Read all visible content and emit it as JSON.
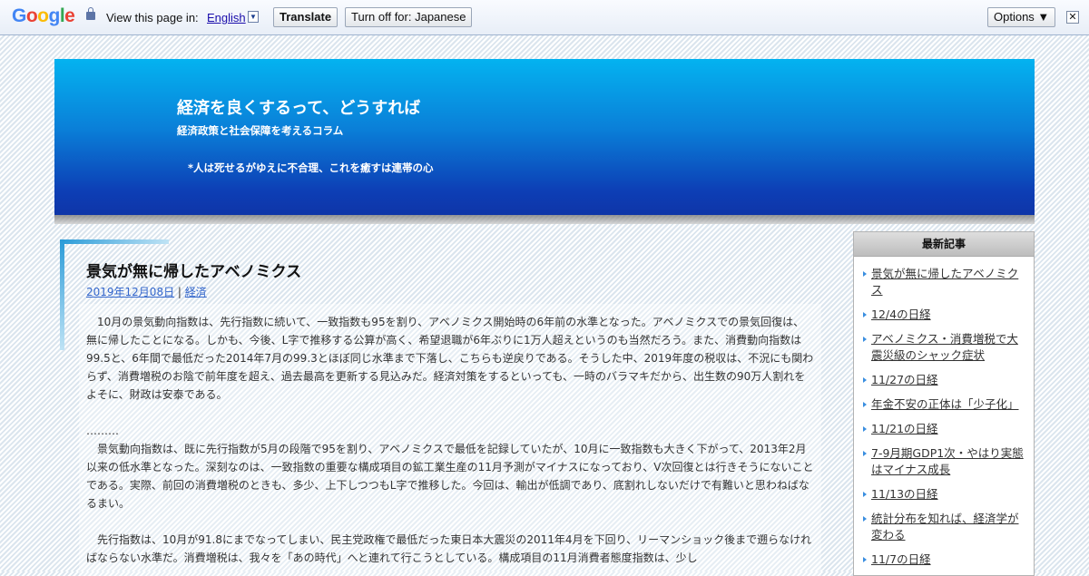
{
  "translate_bar": {
    "logo": "Google",
    "prompt": "View this page in:",
    "language": "English",
    "dropdown_glyph": "▼",
    "translate_label": "Translate",
    "turn_off_label": "Turn off for: Japanese",
    "options_label": "Options ▼",
    "close_glyph": "✕"
  },
  "header": {
    "title": "経済を良くするって、どうすれば",
    "subtitle": "経済政策と社会保障を考えるコラム",
    "motto": "*人は死せるがゆえに不合理、これを癒すは連帯の心"
  },
  "post": {
    "title": "景気が無に帰したアベノミクス",
    "date": "2019年12月08日",
    "separator": "|",
    "category": "経済",
    "paragraphs": [
      "10月の景気動向指数は、先行指数に続いて、一致指数も95を割り、アベノミクス開始時の6年前の水準となった。アベノミクスでの景気回復は、無に帰したことになる。しかも、今後、L字で推移する公算が高く、希望退職が6年ぶりに1万人超えというのも当然だろう。また、消費動向指数は99.5と、6年間で最低だった2014年7月の99.3とほぼ同じ水準まで下落し、こちらも逆戻りである。そうした中、2019年度の税収は、不況にも関わらず、消費増税のお陰で前年度を超え、過去最高を更新する見込みだ。経済対策をするといっても、一時のバラマキだから、出生数の90万人割れをよそに、財政は安泰である。",
      "景気動向指数は、既に先行指数が5月の段階で95を割り、アベノミクスで最低を記録していたが、10月に一致指数も大きく下がって、2013年2月以来の低水準となった。深刻なのは、一致指数の重要な構成項目の鉱工業生産の11月予測がマイナスになっており、V次回復とは行きそうにないことである。実際、前回の消費増税のときも、多少、上下しつつもL字で推移した。今回は、輸出が低調であり、底割れしないだけで有難いと思わねばなるまい。",
      "先行指数は、10月が91.8にまでなってしまい、民主党政権で最低だった東日本大震災の2011年4月を下回り、リーマンショック後まで遡らなければならない水準だ。消費増税は、我々を「あの時代」へと連れて行こうとしている。構成項目の11月消費者態度指数は、少し"
    ],
    "dots": "………"
  },
  "sidebar": {
    "heading": "最新記事",
    "items": [
      "景気が無に帰したアベノミクス",
      "12/4の日経",
      "アベノミクス・消費増税で大震災級のシャック症状",
      "11/27の日経",
      "年金不安の正体は「少子化」",
      "11/21の日経",
      "7-9月期GDP1次・やはり実態はマイナス成長",
      "11/13の日経",
      "統計分布を知れば、経済学が変わる",
      "11/7の日経"
    ]
  }
}
